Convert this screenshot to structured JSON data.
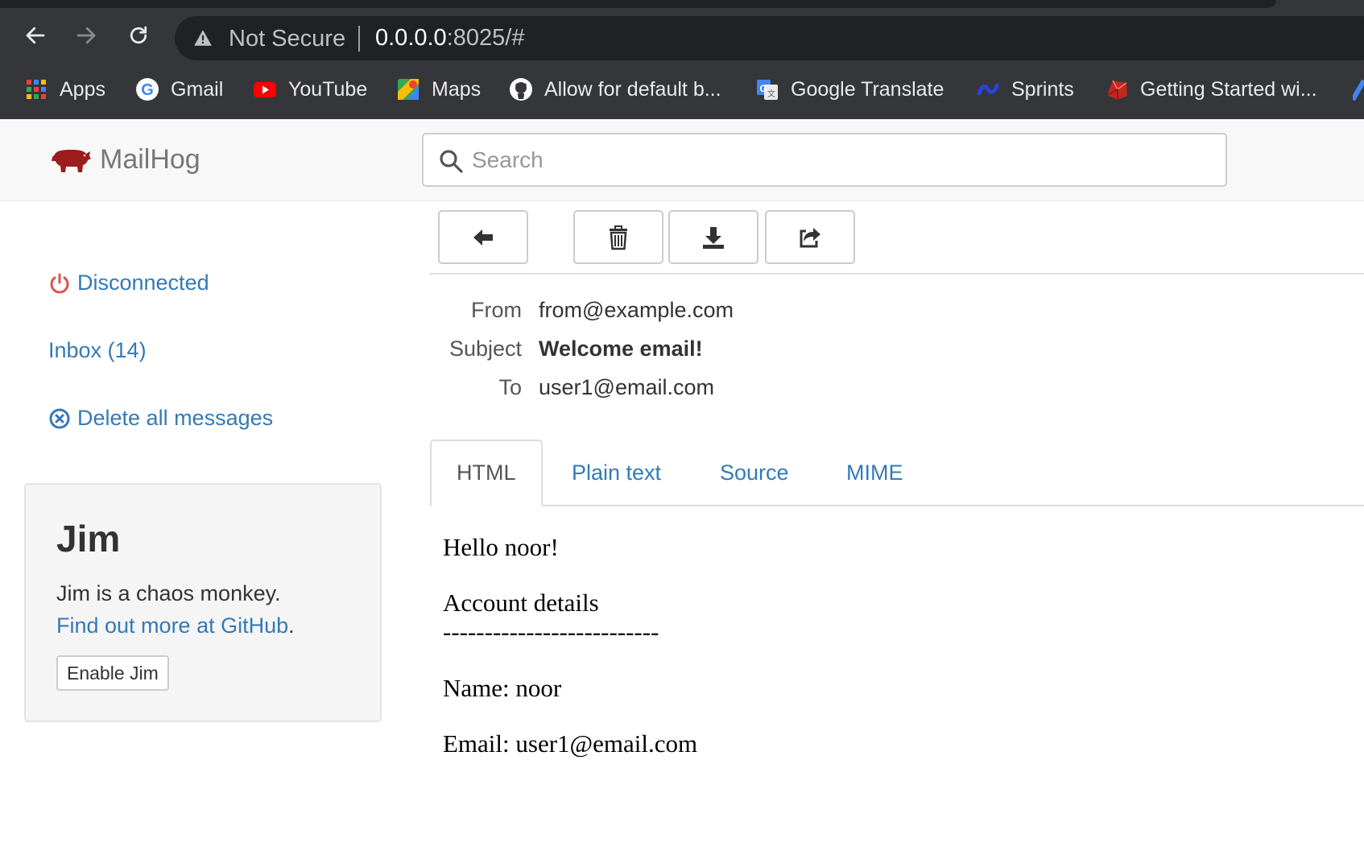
{
  "browser": {
    "security_label": "Not Secure",
    "url_host": "0.0.0.0",
    "url_rest": ":8025/#",
    "bookmarks": [
      {
        "label": "Apps",
        "icon": "apps-grid-icon"
      },
      {
        "label": "Gmail",
        "icon": "google-icon"
      },
      {
        "label": "YouTube",
        "icon": "youtube-icon"
      },
      {
        "label": "Maps",
        "icon": "maps-icon"
      },
      {
        "label": "Allow for default b...",
        "icon": "github-icon"
      },
      {
        "label": "Google Translate",
        "icon": "translate-icon"
      },
      {
        "label": "Sprints",
        "icon": "sprints-icon"
      },
      {
        "label": "Getting Started wi...",
        "icon": "ruby-icon"
      }
    ]
  },
  "app": {
    "brand": "MailHog",
    "search_placeholder": "Search"
  },
  "sidebar": {
    "status": "Disconnected",
    "inbox": "Inbox (14)",
    "delete_all": "Delete all messages",
    "jim": {
      "title": "Jim",
      "description": "Jim is a chaos monkey.",
      "link": "Find out more at GitHub",
      "link_suffix": ".",
      "button": "Enable Jim"
    }
  },
  "message": {
    "labels": {
      "from": "From",
      "subject": "Subject",
      "to": "To"
    },
    "from": "from@example.com",
    "subject": "Welcome email!",
    "to": "user1@email.com",
    "tabs": [
      "HTML",
      "Plain text",
      "Source",
      "MIME"
    ],
    "active_tab": "HTML",
    "body": {
      "greeting": "Hello noor!",
      "heading": "Account details",
      "rule": "--------------------------",
      "name_line": "Name: noor",
      "email_line": "Email: user1@email.com"
    }
  },
  "colors": {
    "link": "#337ab7",
    "status_red": "#d9534f",
    "brand_pig": "#9b1d1d",
    "chrome_bg": "#35363a"
  }
}
